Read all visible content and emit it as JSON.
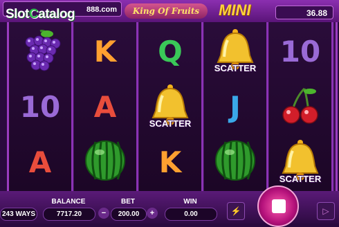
{
  "header": {
    "logo_text_1": "Slot",
    "logo_text_2": "C",
    "logo_text_3": "atalog",
    "jackpot_left": "888.com",
    "title": "King Of Fruits",
    "mini_label": "MINI",
    "jackpot_right": "36.88"
  },
  "reels": [
    [
      {
        "type": "grapes"
      },
      {
        "type": "letter",
        "text": "10",
        "color": "#9a6ad6"
      },
      {
        "type": "letter",
        "text": "A",
        "color": "#e84d3c"
      }
    ],
    [
      {
        "type": "letter",
        "text": "K",
        "color": "#ffa030"
      },
      {
        "type": "letter",
        "text": "A",
        "color": "#e84d3c"
      },
      {
        "type": "watermelon"
      }
    ],
    [
      {
        "type": "letter",
        "text": "Q",
        "color": "#3ac858"
      },
      {
        "type": "bell",
        "label": "SCATTER"
      },
      {
        "type": "letter",
        "text": "K",
        "color": "#ffa030"
      }
    ],
    [
      {
        "type": "bell",
        "label": "SCATTER"
      },
      {
        "type": "letter",
        "text": "J",
        "color": "#3aa8e8"
      },
      {
        "type": "watermelon"
      }
    ],
    [
      {
        "type": "letter",
        "text": "10",
        "color": "#9a6ad6"
      },
      {
        "type": "cherries"
      },
      {
        "type": "bell",
        "label": "SCATTER"
      }
    ]
  ],
  "hud": {
    "ways": "243 WAYS",
    "balance_label": "BALANCE",
    "balance_value": "7717.20",
    "bet_label": "BET",
    "bet_value": "200.00",
    "win_label": "WIN",
    "win_value": "0.00",
    "minus_label": "−",
    "plus_label": "+"
  },
  "icons": {
    "lightning": "lightning-icon",
    "autoplay": "autoplay-icon",
    "spin": "spin-icon"
  }
}
